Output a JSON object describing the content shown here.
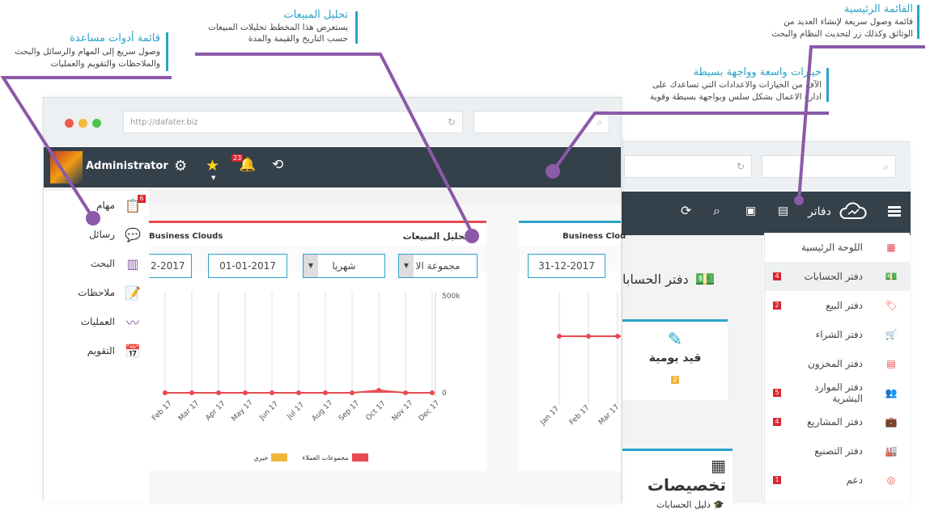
{
  "callouts": {
    "main_menu": {
      "title": "القائمة الرئيسية",
      "body1": "قائمة وصول سريعة لإنشاء العديد من",
      "body2": "الوثائق وكذلك زر لتحديث النظام والبحث"
    },
    "options": {
      "title": "خيارات واسعة وواجهة بسيطة",
      "body1": "الآف من الخيارات والاعدادات التي تساعدك على",
      "body2": "ادارة الاعمال بشكل سلس وبواجهة بسيطة وقوية"
    },
    "sales": {
      "title": "تحليل المبيعات",
      "body1": "يستعرض هذا المخطط تحليلات المبيعات",
      "body2": "حسب التاريخ والقيمة والمدة"
    },
    "tools": {
      "title": "قائمة أدوات مساعدة",
      "body1": "وصول سريع إلى المهام والرسائل والبحث",
      "body2": "والملاحظات والتقويم والعمليات"
    }
  },
  "back_window": {
    "brand": "دفاتر",
    "sidebar": [
      {
        "label": "اللوحة الرئيسية",
        "badge": ""
      },
      {
        "label": "دفتر الحسابات",
        "badge": "4"
      },
      {
        "label": "دفتر البيع",
        "badge": "2"
      },
      {
        "label": "دفتر الشراء",
        "badge": ""
      },
      {
        "label": "دفتر المخزون",
        "badge": ""
      },
      {
        "label": "دفتر الموارد البشرية",
        "badge": "5"
      },
      {
        "label": "دفتر المشاريع",
        "badge": "4"
      },
      {
        "label": "دفتر التصنيع",
        "badge": ""
      },
      {
        "label": "دعم",
        "badge": "1"
      }
    ],
    "page_title": "دفتر الحسابا",
    "card_title": "قيد يومية",
    "card_badge": "2",
    "section_title": "تخصيصات",
    "section_item": "دليل الحسابات",
    "panel_title": "Business Clou",
    "date_to": "31-12-2017",
    "x_ticks": [
      "Jan 17",
      "Feb 17",
      "Mar 17"
    ]
  },
  "front_window": {
    "url": "http://dafater.biz",
    "user": "Administrator",
    "notif_count": "23",
    "left_nav": [
      {
        "label": "مهام",
        "badge": "6",
        "icon": "tasks-icon"
      },
      {
        "label": "رسائل",
        "badge": "",
        "icon": "messages-icon"
      },
      {
        "label": "البحث",
        "badge": "",
        "icon": "search-binders-icon"
      },
      {
        "label": "ملاحظات",
        "badge": "",
        "icon": "notes-icon"
      },
      {
        "label": "العمليات",
        "badge": "",
        "icon": "activity-icon"
      },
      {
        "label": "التقويم",
        "badge": "",
        "icon": "calendar-icon"
      }
    ],
    "panel_left_title": "Business Clouds",
    "panel_right_title": "تحليل المبيعات",
    "group_select": "مجموعة الا",
    "period_select": "شهريا",
    "date_from": "01-01-2017",
    "date_to_partial": "2-2017",
    "y_top": "500k",
    "y_zero": "0",
    "legend": [
      {
        "label": "مجموعات العملاء",
        "color": "#e84a4f"
      },
      {
        "label": "خيري",
        "color": "#f0b63a"
      }
    ]
  },
  "chart_data": {
    "type": "area",
    "categories": [
      "Feb 17",
      "Mar 17",
      "Apr 17",
      "May 17",
      "Jun 17",
      "Jul 17",
      "Aug 17",
      "Sep 17",
      "Oct 17",
      "Nov 17",
      "Dec 17"
    ],
    "series": [
      {
        "name": "مجموعات العملاء",
        "values": [
          0,
          0,
          0,
          0,
          0,
          0,
          0,
          0,
          12000,
          0,
          0
        ]
      }
    ],
    "ylim": [
      0,
      500000
    ]
  },
  "colors": {
    "accent": "#2aa3c9",
    "navbar": "#34404a",
    "purple": "#8b5aa8",
    "red": "#e84a4f"
  }
}
